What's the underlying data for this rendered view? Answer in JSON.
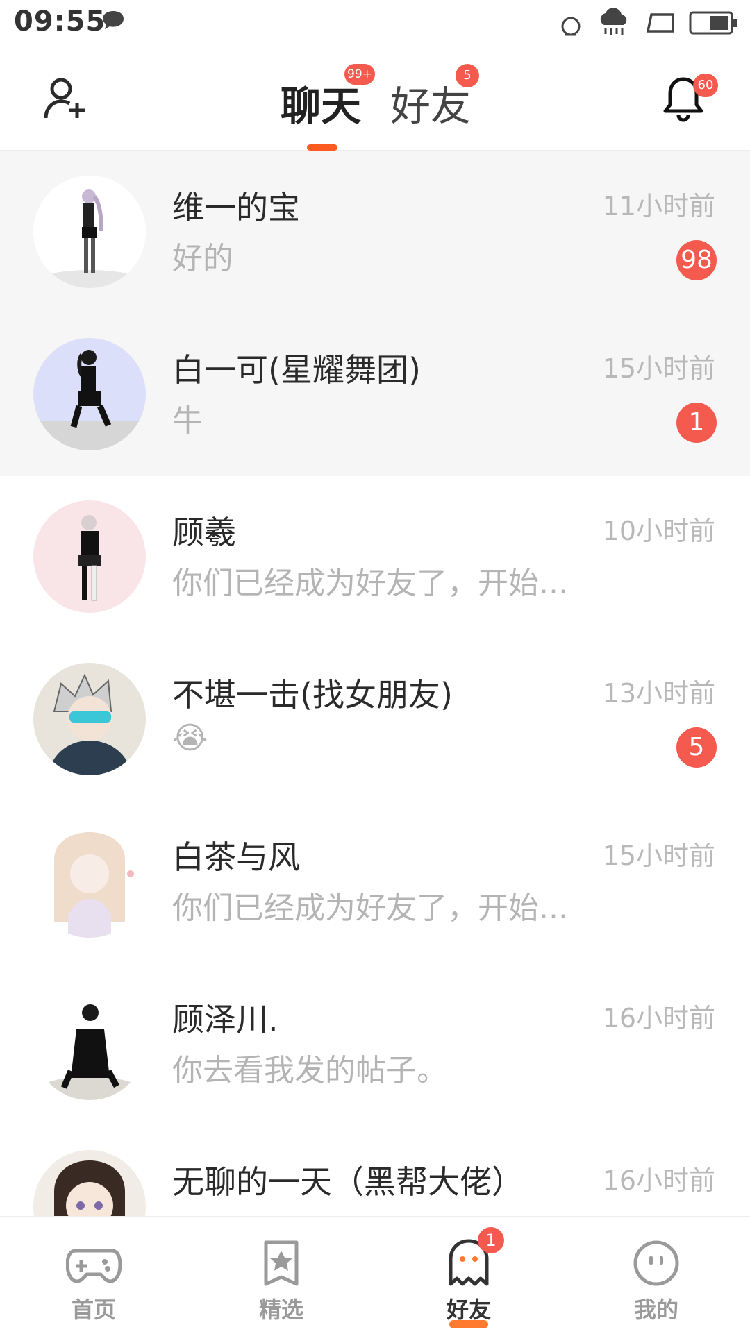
{
  "status_bar": {
    "time": "09:55"
  },
  "header": {
    "tabs": [
      {
        "label": "聊天",
        "badge": "99+",
        "active": true
      },
      {
        "label": "好友",
        "badge": "5",
        "active": false
      }
    ],
    "notification_badge": "60",
    "add_friend_icon": "add-user-icon",
    "bell_icon": "bell-icon"
  },
  "chats": [
    {
      "name": "维一的宝",
      "preview": "好的",
      "time": "11小时前",
      "unread": "98",
      "pinned": true
    },
    {
      "name": "白一可(星耀舞团)",
      "preview": "牛",
      "time": "15小时前",
      "unread": "1",
      "pinned": true
    },
    {
      "name": "顾羲",
      "preview": "你们已经成为好友了，开始...",
      "time": "10小时前",
      "unread": "",
      "pinned": false
    },
    {
      "name": "不堪一击(找女朋友)",
      "preview": "😭",
      "time": "13小时前",
      "unread": "5",
      "pinned": false
    },
    {
      "name": "白茶与风",
      "preview": "你们已经成为好友了，开始...",
      "time": "15小时前",
      "unread": "",
      "pinned": false
    },
    {
      "name": "顾泽川.",
      "preview": "你去看我发的帖子。",
      "time": "16小时前",
      "unread": "",
      "pinned": false
    },
    {
      "name": "无聊的一天（黑帮大佬）",
      "preview": "",
      "time": "16小时前",
      "unread": "",
      "pinned": false
    }
  ],
  "bottom_nav": [
    {
      "label": "首页",
      "icon": "gamepad-icon",
      "active": false,
      "badge": ""
    },
    {
      "label": "精选",
      "icon": "star-bookmark-icon",
      "active": false,
      "badge": ""
    },
    {
      "label": "好友",
      "icon": "ghost-icon",
      "active": true,
      "badge": "1"
    },
    {
      "label": "我的",
      "icon": "face-icon",
      "active": false,
      "badge": ""
    }
  ],
  "colors": {
    "accent": "#ff5a1f",
    "badge": "#f55a4e",
    "muted_text": "#b4b4b4"
  }
}
